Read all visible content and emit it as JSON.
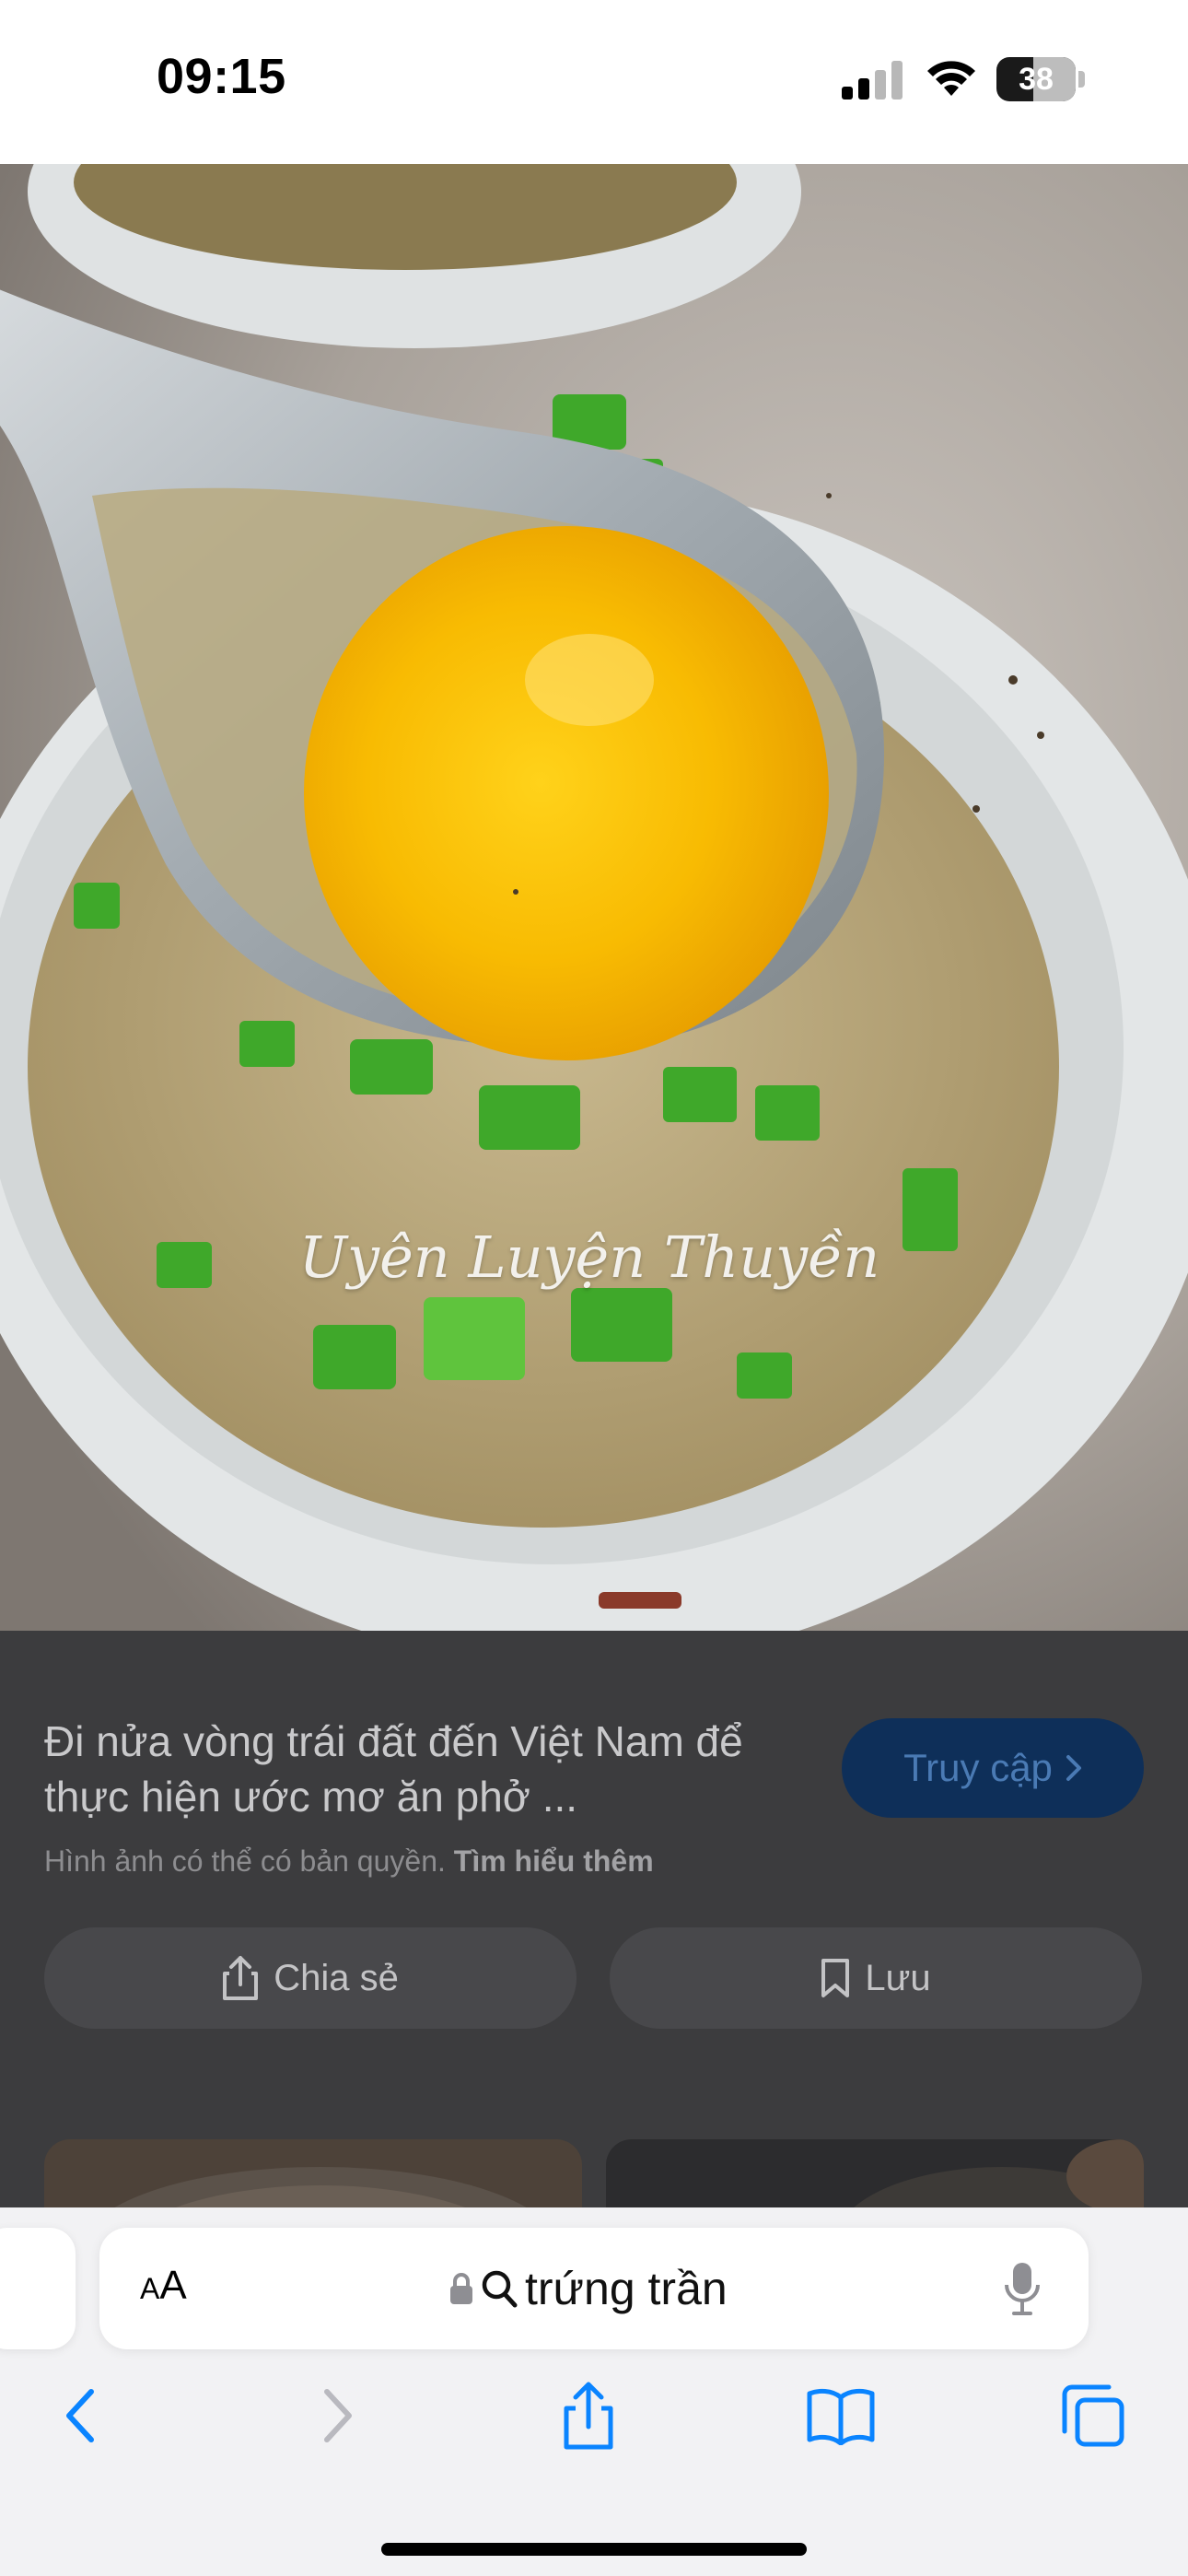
{
  "status_bar": {
    "time": "09:15",
    "battery": "38",
    "icons": [
      "signal-icon",
      "wifi-icon",
      "battery-icon"
    ]
  },
  "image": {
    "watermark": "Uyên Luyện Thuyền",
    "description_colors": {
      "yolk": "#f5b400",
      "broth": "#b8a578",
      "scallion": "#3fa82a",
      "bowl": "#e4e6e6"
    }
  },
  "result": {
    "title": "Đi nửa vòng trái đất đến Việt Nam để thực hiện ước mơ ăn phở ...",
    "copyright_text": "Hình ảnh có thể có bản quyền.",
    "learn_more": "Tìm hiểu thêm",
    "visit_label": "Truy cập",
    "visit_icon": "chevron-right-icon",
    "share_label": "Chia sẻ",
    "share_icon": "share-icon",
    "save_label": "Lưu",
    "save_icon": "bookmark-icon"
  },
  "toolbar": {
    "aa_small": "A",
    "aa_large": "A",
    "search_query": "trứng trần",
    "icons": [
      "lock-icon",
      "search-icon",
      "microphone-icon"
    ],
    "nav_icons": [
      "back-icon",
      "forward-icon",
      "share-icon",
      "bookmarks-icon",
      "tabs-icon"
    ]
  },
  "colors": {
    "panel_bg": "#3c3c3e",
    "visit_bg": "#0e2f59",
    "toolbar_bg": "#f2f2f4"
  }
}
